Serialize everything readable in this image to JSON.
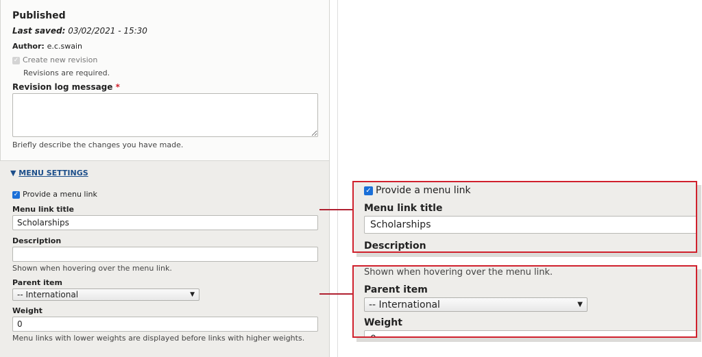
{
  "status": {
    "title": "Published",
    "last_saved_label": "Last saved:",
    "last_saved_value": "03/02/2021 - 15:30",
    "author_label": "Author:",
    "author_value": "e.c.swain"
  },
  "revision": {
    "checkbox_label": "Create new revision",
    "checked": true,
    "note": "Revisions are required.",
    "log_label": "Revision log message",
    "required_mark": "*",
    "log_value": "",
    "log_help": "Briefly describe the changes you have made."
  },
  "menu": {
    "section_title": "MENU SETTINGS",
    "provide_label": "Provide a menu link",
    "provide_checked": true,
    "title_label": "Menu link title",
    "title_value": "Scholarships",
    "description_label": "Description",
    "description_value": "",
    "description_help": "Shown when hovering over the menu link.",
    "parent_label": "Parent item",
    "parent_value": "-- International",
    "weight_label": "Weight",
    "weight_value": "0",
    "weight_help": "Menu links with lower weights are displayed before links with higher weights."
  },
  "colors": {
    "accent": "#1a6fd8",
    "callout": "#d0202c",
    "link": "#1c4e8a"
  }
}
